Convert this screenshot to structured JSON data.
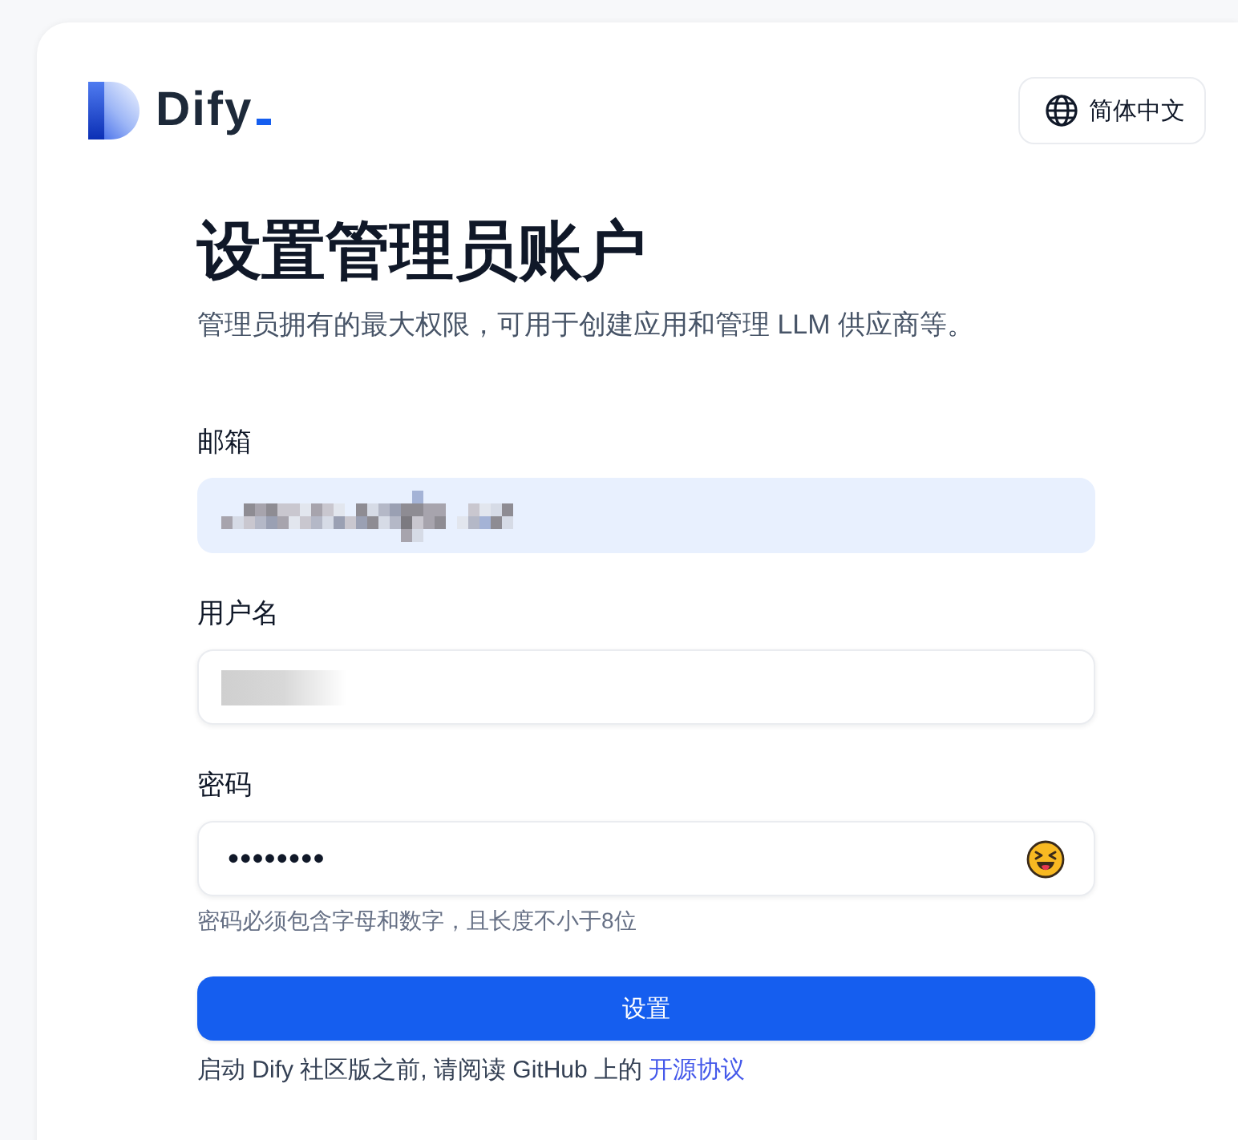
{
  "logo": {
    "text": "Dify"
  },
  "language_button": {
    "label": "简体中文"
  },
  "title": "设置管理员账户",
  "subtitle": "管理员拥有的最大权限，可用于创建应用和管理 LLM 供应商等。",
  "fields": [
    {
      "label": "邮箱",
      "kind": "email",
      "autofilled": true,
      "redaction": {
        "kind": "pixelated"
      }
    },
    {
      "label": "用户名",
      "kind": "text",
      "autofilled": false,
      "redaction": {
        "kind": "blurred"
      }
    },
    {
      "label": "密码",
      "kind": "password",
      "autofilled": false,
      "value": "••••••••",
      "hint": "密码必须包含字母和数字，且长度不小于8位"
    }
  ],
  "submit_button": {
    "label": "设置"
  },
  "notice": {
    "text": "启动 Dify 社区版之前, 请阅读 GitHub 上的",
    "link": "开源协议"
  }
}
